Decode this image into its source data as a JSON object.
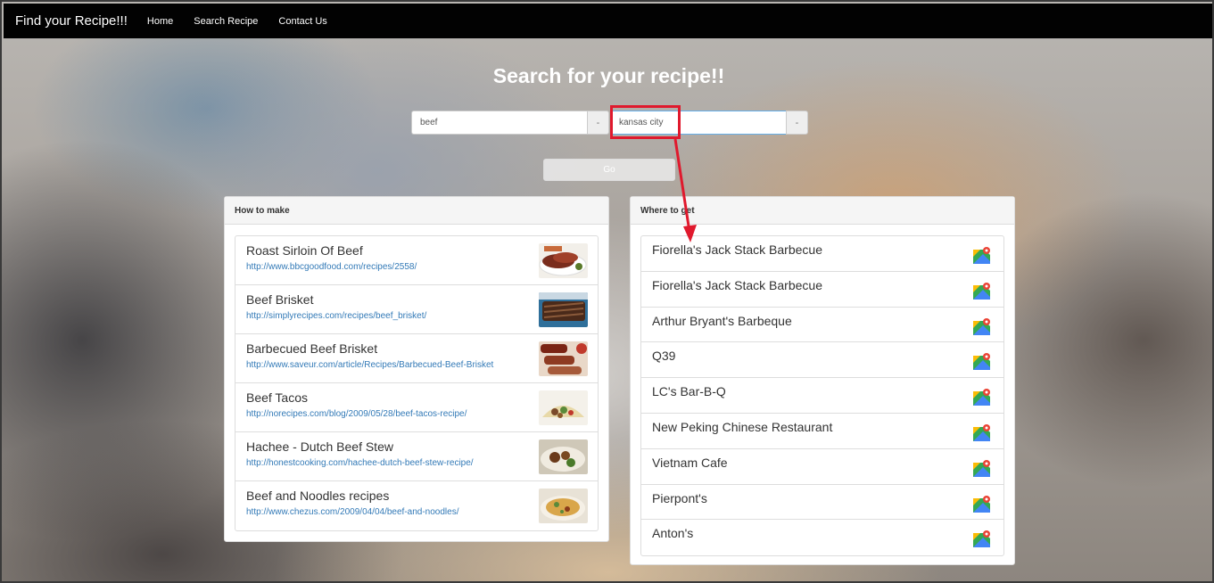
{
  "navbar": {
    "brand": "Find your Recipe!!!",
    "links": [
      "Home",
      "Search Recipe",
      "Contact Us"
    ]
  },
  "hero": {
    "title": "Search for your recipe!!"
  },
  "search": {
    "dish_value": "beef",
    "dish_addon": "-",
    "city_value": "kansas city",
    "city_addon": "-",
    "go_label": "Go"
  },
  "recipes_panel": {
    "heading": "How to make",
    "items": [
      {
        "name": "Roast Sirloin Of Beef",
        "url": "http://www.bbcgoodfood.com/recipes/2558/"
      },
      {
        "name": "Beef Brisket",
        "url": "http://simplyrecipes.com/recipes/beef_brisket/"
      },
      {
        "name": "Barbecued Beef Brisket",
        "url": "http://www.saveur.com/article/Recipes/Barbecued-Beef-Brisket"
      },
      {
        "name": "Beef Tacos",
        "url": "http://norecipes.com/blog/2009/05/28/beef-tacos-recipe/"
      },
      {
        "name": "Hachee - Dutch Beef Stew",
        "url": "http://honestcooking.com/hachee-dutch-beef-stew-recipe/"
      },
      {
        "name": "Beef and Noodles recipes",
        "url": "http://www.chezus.com/2009/04/04/beef-and-noodles/"
      }
    ]
  },
  "places_panel": {
    "heading": "Where to get",
    "items": [
      "Fiorella's Jack Stack Barbecue",
      "Fiorella's Jack Stack Barbecue",
      "Arthur Bryant's Barbeque",
      "Q39",
      "LC's Bar-B-Q",
      "New Peking Chinese Restaurant",
      "Vietnam Cafe",
      "Pierpont's",
      "Anton's"
    ]
  },
  "annotation": {
    "color": "#e0192d"
  }
}
